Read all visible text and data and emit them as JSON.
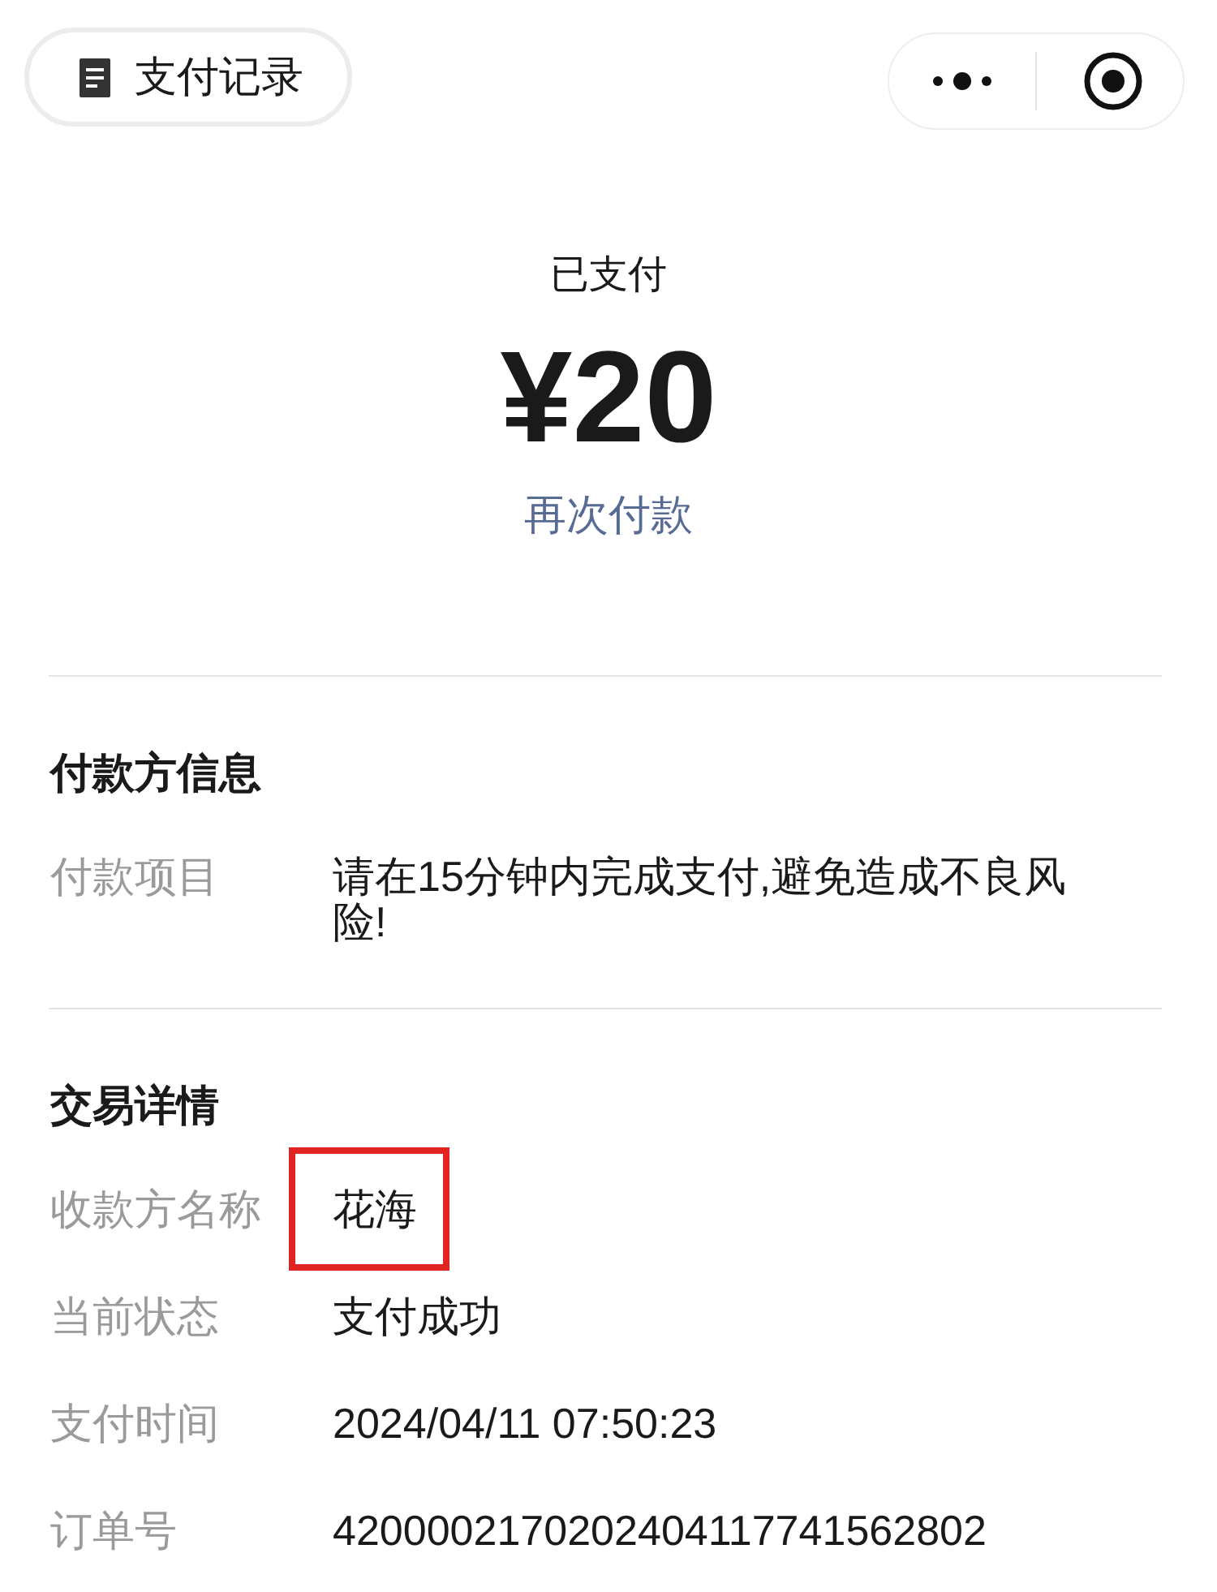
{
  "top_bar": {
    "title": "支付记录"
  },
  "summary": {
    "status": "已支付",
    "amount": "¥20",
    "action": "再次付款"
  },
  "sections": [
    {
      "title": "付款方信息",
      "rows": [
        {
          "label": "付款项目",
          "value": "请在15分钟内完成支付,避免造成不良风险!",
          "highlighted": false
        }
      ]
    },
    {
      "title": "交易详情",
      "rows": [
        {
          "label": "收款方名称",
          "value": "花海",
          "highlighted": true
        },
        {
          "label": "当前状态",
          "value": "支付成功",
          "highlighted": false
        },
        {
          "label": "支付时间",
          "value": "2024/04/11 07:50:23",
          "highlighted": false
        },
        {
          "label": "订单号",
          "value": "4200002170202404117741562802",
          "highlighted": false
        }
      ]
    }
  ]
}
